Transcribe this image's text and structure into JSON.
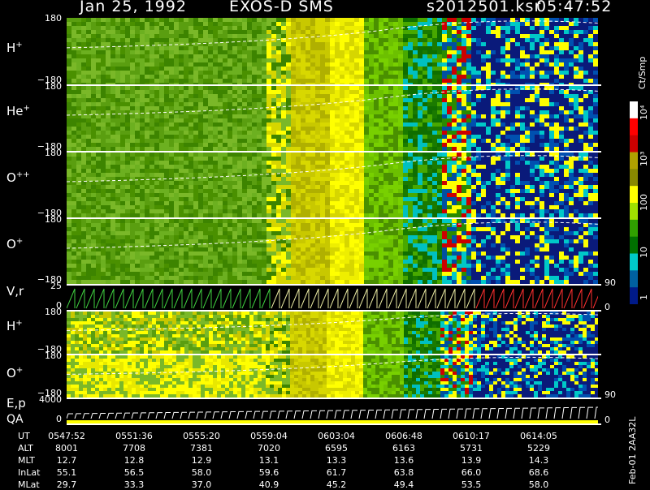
{
  "header": {
    "date": "Jan 25, 1992",
    "instrument": "EXOS-D SMS",
    "file": "s2012501.ksr",
    "time": "05:47:52"
  },
  "panels": [
    {
      "label_main": "H",
      "label_sup": "+",
      "tick_top": "180",
      "tick_bottom": "−180"
    },
    {
      "label_main": "He",
      "label_sup": "+",
      "tick_top": "180",
      "tick_bottom": "−180"
    },
    {
      "label_main": "O",
      "label_sup": "++",
      "tick_top": "180",
      "tick_bottom": "−180"
    },
    {
      "label_main": "O",
      "label_sup": "+",
      "tick_top": "180",
      "tick_bottom": "−180"
    },
    {
      "label_main": "V,r",
      "label_sup": "",
      "tick_top": "25",
      "tick_bottom": "0"
    },
    {
      "label_main": "H",
      "label_sup": "+",
      "tick_top": "180",
      "tick_bottom": "−180"
    },
    {
      "label_main": "O",
      "label_sup": "+",
      "tick_top": "180",
      "tick_bottom": "−180"
    },
    {
      "label_main": "E,p",
      "label_sup": "",
      "tick_top": "4000",
      "tick_bottom": "0"
    }
  ],
  "qa_label": "QA",
  "right_ticks": {
    "p4_top": "90",
    "p4_bottom": "0",
    "p6_top": "90",
    "p7_bottom": "0"
  },
  "colorbar": {
    "title": "Ct/Smp",
    "labels": [
      "10⁴",
      "10³",
      "100",
      "10",
      "1"
    ],
    "colors": [
      "#ffffff",
      "#ff0000",
      "#cc0000",
      "#b0a000",
      "#888800",
      "#ffff00",
      "#a0e000",
      "#30a000",
      "#007000",
      "#00c8c8",
      "#0060a0",
      "#001a88"
    ]
  },
  "footer_id": "Feb-01 2AA32L",
  "ephemeris": {
    "rows": [
      {
        "name": "UT",
        "values": [
          "0547:52",
          "0551:36",
          "0555:20",
          "0559:04",
          "0603:04",
          "0606:48",
          "0610:17",
          "0614:05"
        ]
      },
      {
        "name": "ALT",
        "values": [
          "8001",
          "7708",
          "7381",
          "7020",
          "6595",
          "6163",
          "5731",
          "5229"
        ]
      },
      {
        "name": "MLT",
        "values": [
          "12.7",
          "12.8",
          "12.9",
          "13.1",
          "13.3",
          "13.6",
          "13.9",
          "14.3"
        ]
      },
      {
        "name": "InLat",
        "values": [
          "55.1",
          "56.5",
          "58.0",
          "59.6",
          "61.7",
          "63.8",
          "66.0",
          "68.6"
        ]
      },
      {
        "name": "MLat",
        "values": [
          "29.7",
          "33.3",
          "37.0",
          "40.9",
          "45.2",
          "49.4",
          "53.5",
          "58.0"
        ]
      }
    ]
  },
  "chart_data": {
    "type": "heatmap",
    "title": "Jan 25, 1992   EXOS-D SMS",
    "x_ticks": [
      "0547:52",
      "0551:36",
      "0555:20",
      "0559:04",
      "0603:04",
      "0606:48",
      "0610:17",
      "0614:05"
    ],
    "colorbar_label": "Ct/Smp",
    "colorbar_scale": "log",
    "colorbar_range": [
      1,
      10000
    ],
    "panels": [
      "H+",
      "He+",
      "O++",
      "O+",
      "V,r",
      "H+",
      "O+",
      "E,p"
    ],
    "y_range_angle": [
      -180,
      180
    ],
    "y_range_vr": [
      0,
      25
    ],
    "y_range_ep": [
      0,
      4000
    ]
  }
}
